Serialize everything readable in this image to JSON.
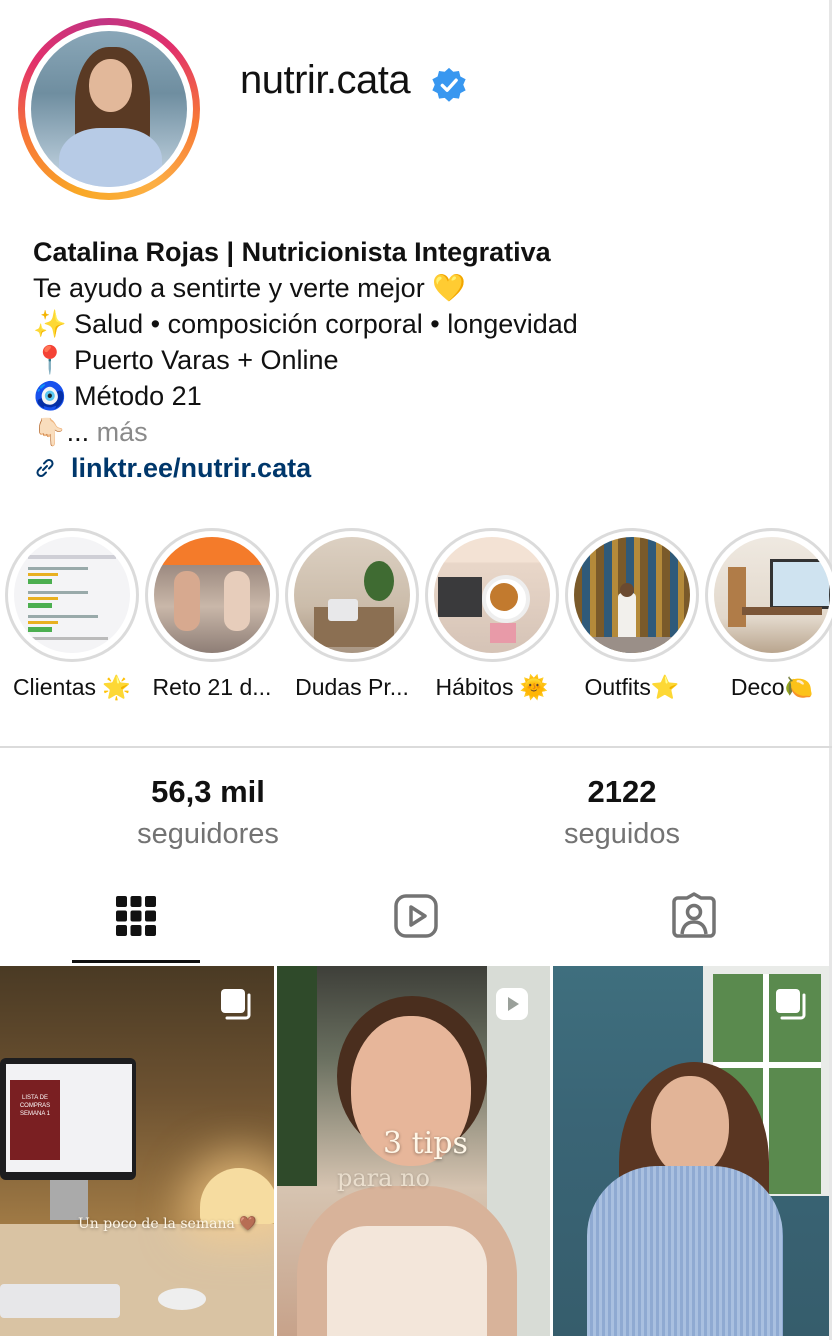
{
  "profile": {
    "username": "nutrir.cata",
    "verified_icon": "verified-badge-icon",
    "accent_color": "#3897f0"
  },
  "bio": {
    "name": "Catalina Rojas | Nutricionista Integrativa",
    "line1": "Te ayudo a sentirte y verte mejor 💛",
    "line2": "✨ Salud • composición corporal • longevidad",
    "line3": "📍 Puerto Varas + Online",
    "line4": "🧿 Método 21",
    "line5_emoji": "👇🏻...",
    "line5_more": "más",
    "link": "linktr.ee/nutrir.cata"
  },
  "highlights": [
    {
      "label": "Clientas 🌟"
    },
    {
      "label": "Reto 21 d..."
    },
    {
      "label": "Dudas Pr..."
    },
    {
      "label": "Hábitos 🌞"
    },
    {
      "label": "Outfits⭐"
    },
    {
      "label": "Deco🍋"
    }
  ],
  "stats": {
    "followers_count": "56,3 mil",
    "followers_label": "seguidores",
    "following_count": "2122",
    "following_label": "seguidos"
  },
  "tabs": [
    {
      "icon": "grid-icon",
      "active": true
    },
    {
      "icon": "reels-icon",
      "active": false
    },
    {
      "icon": "tagged-icon",
      "active": false
    }
  ],
  "posts": [
    {
      "type": "carousel",
      "overlay": "Un poco de la semana 🤎",
      "screen_title": "LISTA DE COMPRAS SEMANA 1"
    },
    {
      "type": "reel",
      "overlay_line1": "3 tips",
      "overlay_line2": "para no"
    },
    {
      "type": "carousel"
    }
  ]
}
